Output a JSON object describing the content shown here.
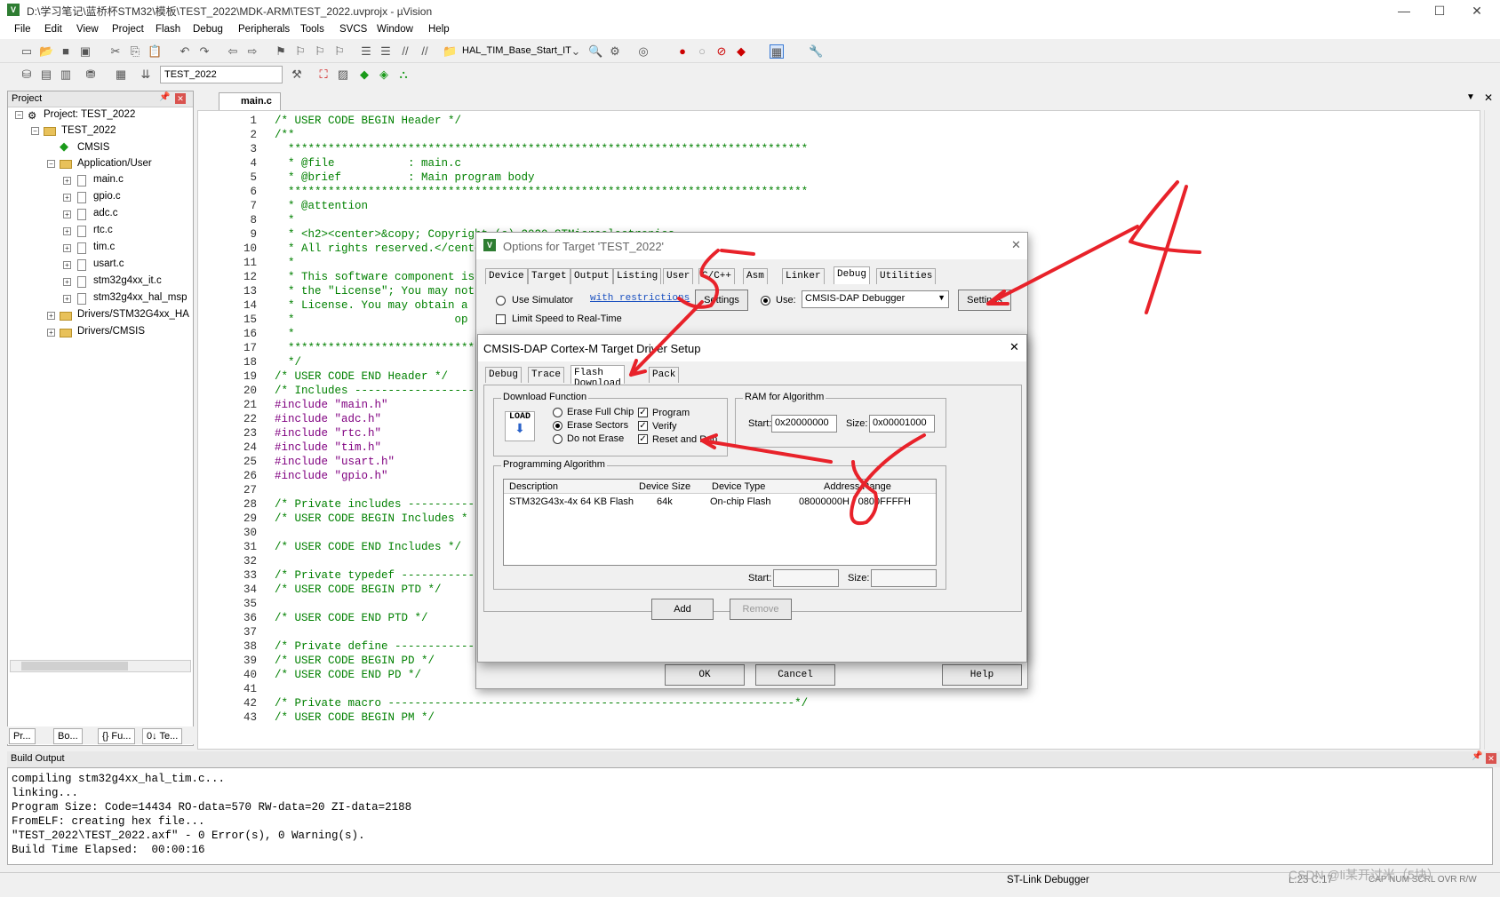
{
  "window": {
    "title": "D:\\学习笔记\\蓝桥杯STM32\\模板\\TEST_2022\\MDK-ARM\\TEST_2022.uvprojx - µVision",
    "min": "—",
    "max": "☐",
    "close": "✕"
  },
  "menu": [
    "File",
    "Edit",
    "View",
    "Project",
    "Flash",
    "Debug",
    "Peripherals",
    "Tools",
    "SVCS",
    "Window",
    "Help"
  ],
  "toolbar": {
    "function_combo": "HAL_TIM_Base_Start_IT",
    "target_combo": "TEST_2022"
  },
  "project": {
    "header": "Project",
    "root": "Project: TEST_2022",
    "target": "TEST_2022",
    "cmsis": "CMSIS",
    "group": "Application/User",
    "files": [
      "main.c",
      "gpio.c",
      "adc.c",
      "rtc.c",
      "tim.c",
      "usart.c",
      "stm32g4xx_it.c",
      "stm32g4xx_hal_msp"
    ],
    "drivers": [
      "Drivers/STM32G4xx_HA",
      "Drivers/CMSIS"
    ],
    "tabs": [
      "Pr...",
      "Bo...",
      "{} Fu...",
      "0↓ Te..."
    ]
  },
  "editor": {
    "tab": "main.c",
    "lines": [
      {
        "n": "1",
        "t": "/* USER CODE BEGIN Header */"
      },
      {
        "n": "2",
        "t": "/**"
      },
      {
        "n": "3",
        "t": "  ******************************************************************************"
      },
      {
        "n": "4",
        "t": "  * @file           : main.c"
      },
      {
        "n": "5",
        "t": "  * @brief          : Main program body"
      },
      {
        "n": "6",
        "t": "  ******************************************************************************"
      },
      {
        "n": "7",
        "t": "  * @attention"
      },
      {
        "n": "8",
        "t": "  *"
      },
      {
        "n": "9",
        "t": "  * <h2><center>&copy; Copyright (c) 2020 STMicroelectronics."
      },
      {
        "n": "10",
        "t": "  * All rights reserved.</center></h2>"
      },
      {
        "n": "11",
        "t": "  *"
      },
      {
        "n": "12",
        "t": "  * This software component is"
      },
      {
        "n": "13",
        "t": "  * the \"License\"; You may not"
      },
      {
        "n": "14",
        "t": "  * License. You may obtain a"
      },
      {
        "n": "15",
        "t": "  *                        op"
      },
      {
        "n": "16",
        "t": "  *"
      },
      {
        "n": "17",
        "t": "  ****************************"
      },
      {
        "n": "18",
        "t": "  */"
      },
      {
        "n": "19",
        "t": "/* USER CODE END Header */"
      },
      {
        "n": "20",
        "t": "/* Includes ------------------"
      },
      {
        "n": "21",
        "t": "#include \"main.h\""
      },
      {
        "n": "22",
        "t": "#include \"adc.h\""
      },
      {
        "n": "23",
        "t": "#include \"rtc.h\""
      },
      {
        "n": "24",
        "t": "#include \"tim.h\""
      },
      {
        "n": "25",
        "t": "#include \"usart.h\""
      },
      {
        "n": "26",
        "t": "#include \"gpio.h\""
      },
      {
        "n": "27",
        "t": ""
      },
      {
        "n": "28",
        "t": "/* Private includes ----------"
      },
      {
        "n": "29",
        "t": "/* USER CODE BEGIN Includes *"
      },
      {
        "n": "30",
        "t": ""
      },
      {
        "n": "31",
        "t": "/* USER CODE END Includes */"
      },
      {
        "n": "32",
        "t": ""
      },
      {
        "n": "33",
        "t": "/* Private typedef -----------"
      },
      {
        "n": "34",
        "t": "/* USER CODE BEGIN PTD */"
      },
      {
        "n": "35",
        "t": ""
      },
      {
        "n": "36",
        "t": "/* USER CODE END PTD */"
      },
      {
        "n": "37",
        "t": ""
      },
      {
        "n": "38",
        "t": "/* Private define ------------"
      },
      {
        "n": "39",
        "t": "/* USER CODE BEGIN PD */"
      },
      {
        "n": "40",
        "t": "/* USER CODE END PD */"
      },
      {
        "n": "41",
        "t": ""
      },
      {
        "n": "42",
        "t": "/* Private macro -------------------------------------------------------------*/"
      },
      {
        "n": "43",
        "t": "/* USER CODE BEGIN PM */"
      }
    ]
  },
  "build": {
    "header": "Build Output",
    "lines": [
      "compiling stm32g4xx_hal_tim.c...",
      "linking...",
      "Program Size: Code=14434 RO-data=570 RW-data=20 ZI-data=2188",
      "FromELF: creating hex file...",
      "\"TEST_2022\\TEST_2022.axf\" - 0 Error(s), 0 Warning(s).",
      "Build Time Elapsed:  00:00:16"
    ]
  },
  "status": {
    "debugger": "ST-Link Debugger",
    "pos": "L:23 C:17",
    "caps": "CAP NUM SCRL OVR R/W",
    "watermark": "CSDN @li某开过米（5块）"
  },
  "options_dialog": {
    "title": "Options for Target 'TEST_2022'",
    "tabs": [
      "Device",
      "Target",
      "Output",
      "Listing",
      "User",
      "C/C++",
      "Asm",
      "Linker",
      "Debug",
      "Utilities"
    ],
    "use_simulator": "Use Simulator",
    "restrictions": "with restrictions",
    "settings": "Settings",
    "limit_speed": "Limit Speed to Real-Time",
    "use": "Use:",
    "debugger": "CMSIS-DAP Debugger",
    "settings2": "Settings",
    "ok": "OK",
    "cancel": "Cancel",
    "help": "Help"
  },
  "setup_dialog": {
    "title": "CMSIS-DAP Cortex-M Target Driver Setup",
    "close": "✕",
    "tabs": [
      "Debug",
      "Trace",
      "Flash Download",
      "Pack"
    ],
    "download_function": "Download Function",
    "load": "LOAD",
    "erase_full": "Erase Full Chip",
    "erase_sectors": "Erase Sectors",
    "do_not_erase": "Do not Erase",
    "program": "Program",
    "verify": "Verify",
    "reset_run": "Reset and Run",
    "ram": "RAM for Algorithm",
    "start_lbl": "Start:",
    "start_val": "0x20000000",
    "size_lbl": "Size:",
    "size_val": "0x00001000",
    "prog_algo": "Programming Algorithm",
    "cols": [
      "Description",
      "Device Size",
      "Device Type",
      "Address Range"
    ],
    "row": [
      "STM32G43x-4x 64 KB Flash",
      "64k",
      "On-chip Flash",
      "08000000H - 0800FFFFH"
    ],
    "start2": "Start:",
    "size2": "Size:",
    "add": "Add",
    "remove": "Remove"
  },
  "colors": {
    "annotation": "#e8222a",
    "code_comment": "#008000",
    "preproc": "#800080"
  }
}
